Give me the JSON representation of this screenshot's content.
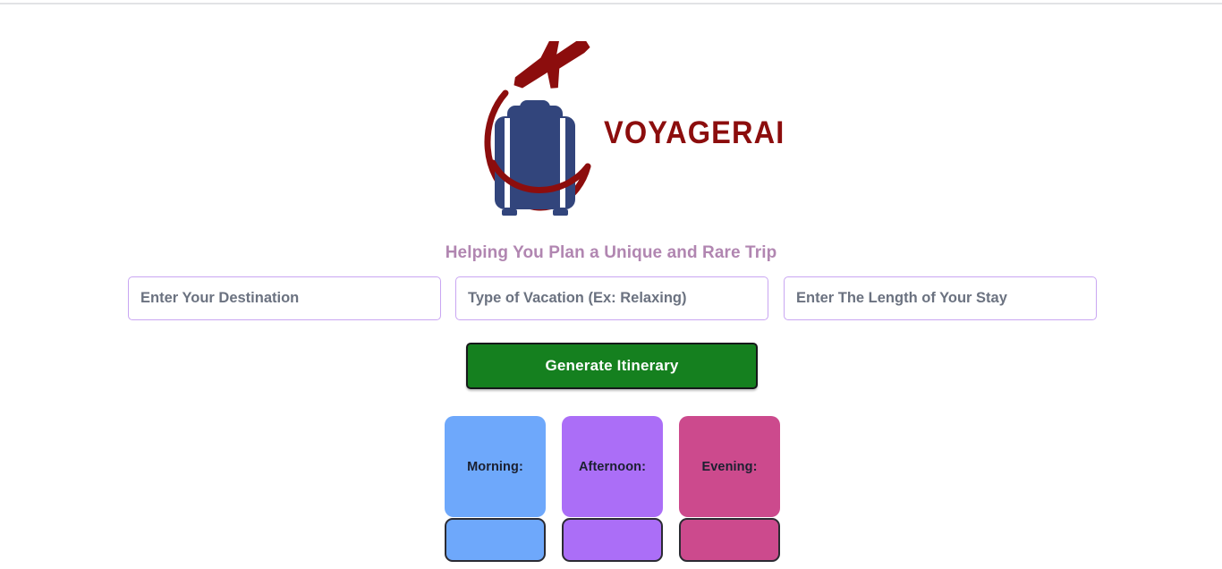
{
  "brand": {
    "name": "VOYAGERAI",
    "logo_icon": "suitcase-airplane-arc-logo",
    "colors": {
      "wordmark_red": "#8c0d0d",
      "suitcase_navy": "#32457c",
      "tagline_mauve": "#b186b1"
    }
  },
  "tagline": "Helping You Plan a Unique and Rare Trip",
  "form": {
    "destination": {
      "value": "",
      "placeholder": "Enter Your Destination"
    },
    "vacation_type": {
      "value": "",
      "placeholder": "Type of Vacation (Ex: Relaxing)"
    },
    "length_of_stay": {
      "value": "",
      "placeholder": "Enter The Length of Your Stay"
    },
    "submit_label": "Generate Itinerary",
    "submit_color": "#15801f",
    "field_border_color": "#c9a6f2"
  },
  "itinerary": {
    "slots": [
      {
        "label": "Morning:",
        "content": "",
        "color": "#6ea8fb"
      },
      {
        "label": "Afternoon:",
        "content": "",
        "color": "#ab6ef7"
      },
      {
        "label": "Evening:",
        "content": "",
        "color": "#cc4a8d"
      }
    ]
  }
}
